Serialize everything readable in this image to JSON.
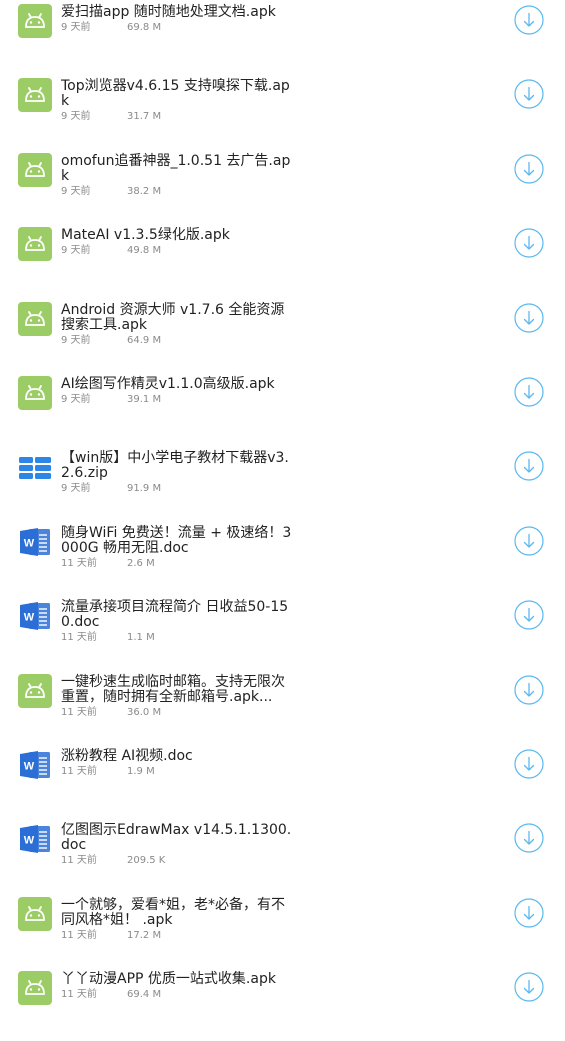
{
  "files": [
    {
      "name": "爱扫描app 随时随地处理文档.apk",
      "time": "9 天前",
      "size": "69.8 M",
      "type": "apk",
      "icon": "android-icon"
    },
    {
      "name": "Top浏览器v4.6.15 支持嗅探下载.apk",
      "time": "9 天前",
      "size": "31.7 M",
      "type": "apk",
      "icon": "android-icon"
    },
    {
      "name": "omofun追番神器_1.0.51 去广告.apk",
      "time": "9 天前",
      "size": "38.2 M",
      "type": "apk",
      "icon": "android-icon"
    },
    {
      "name": "MateAI v1.3.5绿化版.apk",
      "time": "9 天前",
      "size": "49.8 M",
      "type": "apk",
      "icon": "android-icon"
    },
    {
      "name": "Android 资源大师 v1.7.6 全能资源搜索工具.apk",
      "time": "9 天前",
      "size": "64.9 M",
      "type": "apk",
      "icon": "android-icon"
    },
    {
      "name": "AI绘图写作精灵v1.1.0高级版.apk",
      "time": "9 天前",
      "size": "39.1 M",
      "type": "apk",
      "icon": "android-icon"
    },
    {
      "name": "【win版】中小学电子教材下载器v3.2.6.zip",
      "time": "9 天前",
      "size": "91.9 M",
      "type": "zip",
      "icon": "archive-icon"
    },
    {
      "name": "随身WiFi 免费送！流量 + 极速络！3000G 畅用无阻.doc",
      "time": "11 天前",
      "size": "2.6 M",
      "type": "doc",
      "icon": "word-icon"
    },
    {
      "name": "流量承接项目流程简介 日收益50-150.doc",
      "time": "11 天前",
      "size": "1.1 M",
      "type": "doc",
      "icon": "word-icon"
    },
    {
      "name": "一键秒速生成临时邮箱。支持无限次重置，随时拥有全新邮箱号.apk...",
      "time": "11 天前",
      "size": "36.0 M",
      "type": "apk",
      "icon": "android-icon"
    },
    {
      "name": "涨粉教程 AI视频.doc",
      "time": "11 天前",
      "size": "1.9 M",
      "type": "doc",
      "icon": "word-icon"
    },
    {
      "name": "亿图图示EdrawMax v14.5.1.1300.doc",
      "time": "11 天前",
      "size": "209.5 K",
      "type": "doc",
      "icon": "word-icon"
    },
    {
      "name": "一个就够，爱看*姐，老*必备，有不同风格*姐！ .apk",
      "time": "11 天前",
      "size": "17.2 M",
      "type": "apk",
      "icon": "android-icon"
    },
    {
      "name": "丫丫动漫APP 优质一站式收集.apk",
      "time": "11 天前",
      "size": "69.4 M",
      "type": "apk",
      "icon": "android-icon"
    }
  ],
  "colors": {
    "android": "#9ccc65",
    "word": "#2b6fd6",
    "archive": "#2d86e6",
    "download": "#5ab8ee",
    "text": "#222222",
    "meta": "#8a8a8a"
  },
  "icons": {
    "download": "download-circle-icon"
  }
}
